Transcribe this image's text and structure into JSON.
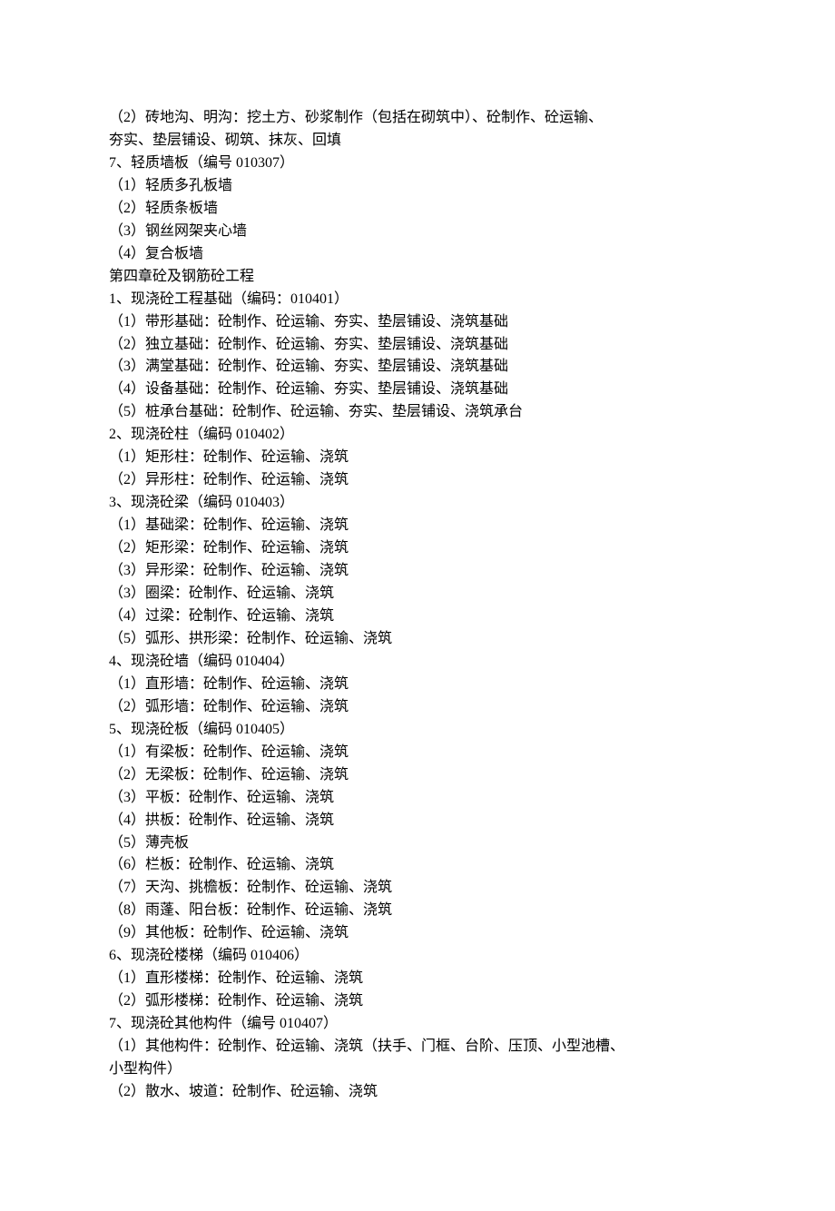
{
  "lines": [
    "（2）砖地沟、明沟：挖土方、砂浆制作（包括在砌筑中）、砼制作、砼运输、",
    "夯实、垫层铺设、砌筑、抹灰、回填",
    "7、轻质墙板（编号 010307）",
    "（1）轻质多孔板墙",
    "（2）轻质条板墙",
    "（3）钢丝网架夹心墙",
    "（4）复合板墙",
    "第四章砼及钢筋砼工程",
    "1、现浇砼工程基础（编码：010401）",
    "（1）带形基础：砼制作、砼运输、夯实、垫层铺设、浇筑基础",
    "（2）独立基础：砼制作、砼运输、夯实、垫层铺设、浇筑基础",
    "（3）满堂基础：砼制作、砼运输、夯实、垫层铺设、浇筑基础",
    "（4）设备基础：砼制作、砼运输、夯实、垫层铺设、浇筑基础",
    "（5）桩承台基础：砼制作、砼运输、夯实、垫层铺设、浇筑承台",
    "2、现浇砼柱（编码 010402）",
    "（1）矩形柱：砼制作、砼运输、浇筑",
    "（2）异形柱：砼制作、砼运输、浇筑",
    "3、现浇砼梁（编码 010403）",
    "（1）基础梁：砼制作、砼运输、浇筑",
    "（2）矩形梁：砼制作、砼运输、浇筑",
    "（3）异形梁：砼制作、砼运输、浇筑",
    "（3）圈梁：砼制作、砼运输、浇筑",
    "（4）过梁：砼制作、砼运输、浇筑",
    "（5）弧形、拱形梁：砼制作、砼运输、浇筑",
    "4、现浇砼墙（编码 010404）",
    "（1）直形墙：砼制作、砼运输、浇筑",
    "（2）弧形墙：砼制作、砼运输、浇筑",
    "5、现浇砼板（编码 010405）",
    "（1）有梁板：砼制作、砼运输、浇筑",
    "（2）无梁板：砼制作、砼运输、浇筑",
    "（3）平板：砼制作、砼运输、浇筑",
    "（4）拱板：砼制作、砼运输、浇筑",
    "（5）薄壳板",
    "（6）栏板：砼制作、砼运输、浇筑",
    "（7）天沟、挑檐板：砼制作、砼运输、浇筑",
    "（8）雨蓬、阳台板：砼制作、砼运输、浇筑",
    "（9）其他板：砼制作、砼运输、浇筑",
    "6、现浇砼楼梯（编码 010406）",
    "（1）直形楼梯：砼制作、砼运输、浇筑",
    "（2）弧形楼梯：砼制作、砼运输、浇筑",
    "7、现浇砼其他构件（编号 010407）",
    "（1）其他构件：砼制作、砼运输、浇筑（扶手、门框、台阶、压顶、小型池槽、",
    "小型构件）",
    "（2）散水、坡道：砼制作、砼运输、浇筑"
  ]
}
